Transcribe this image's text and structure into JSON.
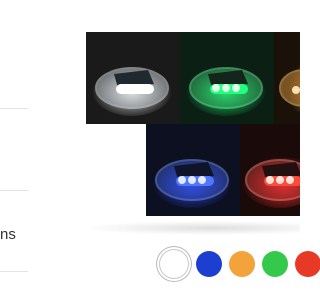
{
  "product_options": {
    "partial_label": "ns"
  },
  "gallery": {
    "tiles": [
      {
        "color_name": "white",
        "glow": "#eef4ff",
        "tint": "#ffffff"
      },
      {
        "color_name": "green",
        "glow": "#1dff74",
        "tint": "#22ff80"
      },
      {
        "color_name": "orange",
        "glow": "#ffb84a",
        "tint": "#ffb84a"
      },
      {
        "color_name": "blue",
        "glow": "#2a4bff",
        "tint": "#4f78ff"
      },
      {
        "color_name": "red",
        "glow": "#ff2a2a",
        "tint": "#ff4a3a"
      }
    ]
  },
  "swatches": [
    {
      "name": "white",
      "hex": "#ffffff",
      "selected": true
    },
    {
      "name": "blue",
      "hex": "#1d3fcf",
      "selected": false
    },
    {
      "name": "orange",
      "hex": "#f2a33a",
      "selected": false
    },
    {
      "name": "green",
      "hex": "#34c94a",
      "selected": false
    },
    {
      "name": "red",
      "hex": "#e83826",
      "selected": false
    }
  ]
}
